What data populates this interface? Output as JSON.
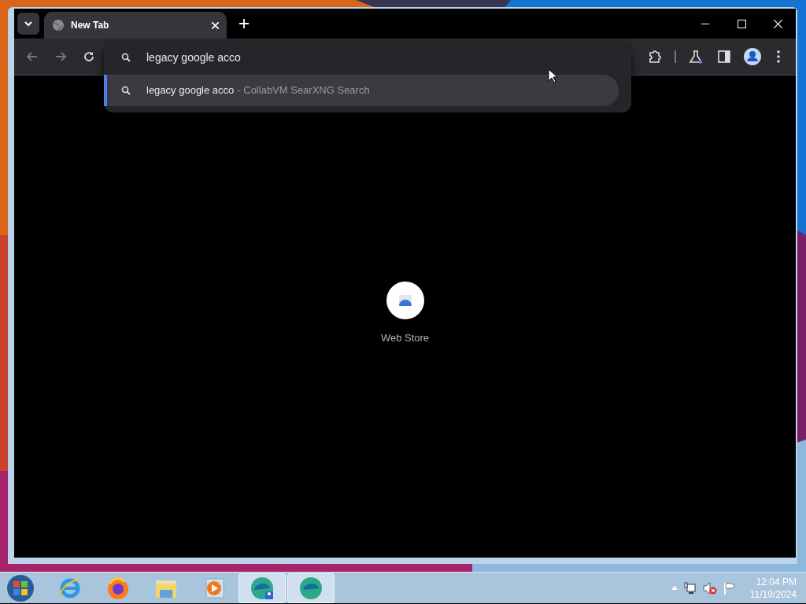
{
  "browser": {
    "tabs": [
      {
        "title": "New Tab",
        "selected": true
      }
    ],
    "omnibox": {
      "value": "legacy google acco"
    },
    "suggestions": [
      {
        "query": "legacy google acco",
        "source": "- CollabVM SearXNG Search",
        "selected": true
      }
    ],
    "shortcuts": [
      {
        "label": "Web Store"
      }
    ]
  },
  "taskbar": {
    "apps": [
      {
        "kind": "ie",
        "active": false
      },
      {
        "kind": "firefox",
        "active": false
      },
      {
        "kind": "explorer",
        "active": false
      },
      {
        "kind": "media",
        "active": false
      },
      {
        "kind": "edge-user",
        "active": true
      },
      {
        "kind": "edge",
        "active": true
      }
    ],
    "clock": {
      "time": "12:04 PM",
      "date": "11/19/2024"
    }
  }
}
